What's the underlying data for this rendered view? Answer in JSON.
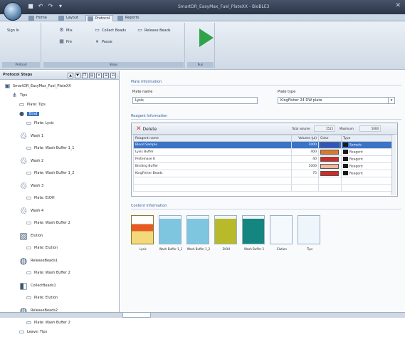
{
  "titlebar": {
    "title": "SmartDR_EasyMax_Fuel_PlateXX - BioBLE3",
    "close": "✕"
  },
  "tabs": [
    {
      "label": "Home"
    },
    {
      "label": "Layout"
    },
    {
      "label": "Protocol"
    },
    {
      "label": "Reports"
    }
  ],
  "ribbon": {
    "groups": [
      "Protocol",
      "Steps",
      "Run"
    ],
    "sign_in": "Sign In",
    "buttons": {
      "mix": "Mix",
      "collect_beads": "Collect Beads",
      "release_beads": "Release Beads",
      "pre": "Pre",
      "pause": "Pause"
    }
  },
  "left_panel": {
    "title": "Protocol Steps",
    "tree": [
      {
        "label": "SmartDR_EasyMax_Fuel_PlateXX",
        "level": 0,
        "icon": "protocol-icon"
      },
      {
        "label": "Tips",
        "level": 1,
        "icon": "tips-icon"
      },
      {
        "label": "Plate: Tips",
        "level": 2,
        "icon": "plate-icon"
      },
      {
        "label": "Bind",
        "level": 2,
        "icon": "step-icon",
        "selected": true
      },
      {
        "label": "Plate: Lysis",
        "level": 3,
        "icon": "plate-icon"
      },
      {
        "label": "Wash 1",
        "level": 2,
        "icon": "wash-icon"
      },
      {
        "label": "Plate: Wash Buffer 1_1",
        "level": 3,
        "icon": "plate-icon"
      },
      {
        "label": "Wash 2",
        "level": 2,
        "icon": "wash-icon"
      },
      {
        "label": "Plate: Wash Buffer 1_2",
        "level": 3,
        "icon": "plate-icon"
      },
      {
        "label": "Wash 3",
        "level": 2,
        "icon": "wash-icon"
      },
      {
        "label": "Plate: EtOH",
        "level": 3,
        "icon": "plate-icon"
      },
      {
        "label": "Wash 4",
        "level": 2,
        "icon": "wash-icon"
      },
      {
        "label": "Plate: Wash Buffer 2",
        "level": 3,
        "icon": "plate-icon"
      },
      {
        "label": "Elution",
        "level": 2,
        "icon": "elution-icon"
      },
      {
        "label": "Plate: Elution",
        "level": 3,
        "icon": "plate-icon"
      },
      {
        "label": "ReleaseBeads1",
        "level": 2,
        "icon": "beads-icon"
      },
      {
        "label": "Plate: Wash Buffer 2",
        "level": 3,
        "icon": "plate-icon"
      },
      {
        "label": "CollectBeads1",
        "level": 2,
        "icon": "collect-icon"
      },
      {
        "label": "Plate: Elution",
        "level": 3,
        "icon": "plate-icon"
      },
      {
        "label": "ReleaseBeads2",
        "level": 2,
        "icon": "beads-icon"
      },
      {
        "label": "Plate: Wash Buffer 2",
        "level": 3,
        "icon": "plate-icon"
      },
      {
        "label": "Leave: Tips",
        "level": 2,
        "icon": "plate-icon"
      }
    ]
  },
  "plate_info": {
    "section": "Plate Information",
    "name_label": "Plate name",
    "name_value": "Lysis",
    "type_label": "Plate type",
    "type_value": "KingFisher 24 DW plate"
  },
  "reagent_info": {
    "section": "Reagent Information",
    "delete_label": "Delete",
    "total_volume_label": "Total volume",
    "total_volume_value": "1515",
    "maximum_label": "Maximum",
    "maximum_value": "5000",
    "columns": [
      "Reagent name",
      "Volume (µl)",
      "Color",
      "Type"
    ],
    "rows": [
      {
        "name": "Blood Sample",
        "volume": "1000",
        "color": "#2a55c8",
        "type": "Sample",
        "selected": true
      },
      {
        "name": "Lysis Buffer",
        "volume": "400",
        "color": "#d97a2a",
        "type": "Reagent"
      },
      {
        "name": "Proteinase K",
        "volume": "40",
        "color": "#d42a24",
        "type": "Reagent"
      },
      {
        "name": "Binding Buffer",
        "volume": "1000",
        "color": "#f2b99a",
        "type": "Reagent"
      },
      {
        "name": "KingFisher Beads",
        "volume": "75",
        "color": "#d42a24",
        "type": "Reagent"
      }
    ]
  },
  "content_info": {
    "section": "Content Information",
    "tiles": [
      {
        "caption": "Lysis",
        "color": "#e85a24",
        "selected": true
      },
      {
        "caption": "Wash Buffer 1_1",
        "color": "#7ec6df"
      },
      {
        "caption": "Wash Buffer 1_2",
        "color": "#7ec6df"
      },
      {
        "caption": "EtOH",
        "color": "#b9ba2a"
      },
      {
        "caption": "Wash Buffer 2",
        "color": "#14857f"
      },
      {
        "caption": "Elution",
        "color": "#f3f9fd"
      },
      {
        "caption": "Tips",
        "color": "#eef6fc"
      }
    ]
  }
}
